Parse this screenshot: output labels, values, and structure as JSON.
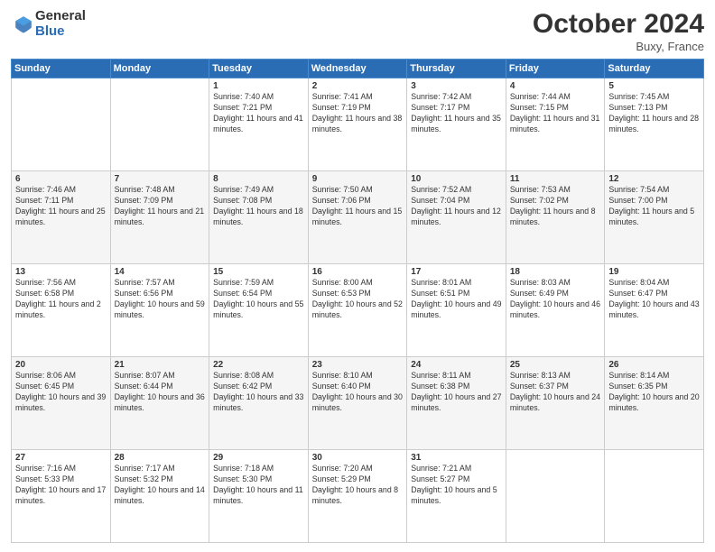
{
  "logo": {
    "general": "General",
    "blue": "Blue"
  },
  "header": {
    "title": "October 2024",
    "location": "Buxy, France"
  },
  "weekdays": [
    "Sunday",
    "Monday",
    "Tuesday",
    "Wednesday",
    "Thursday",
    "Friday",
    "Saturday"
  ],
  "weeks": [
    [
      {
        "day": "",
        "sunrise": "",
        "sunset": "",
        "daylight": ""
      },
      {
        "day": "",
        "sunrise": "",
        "sunset": "",
        "daylight": ""
      },
      {
        "day": "1",
        "sunrise": "Sunrise: 7:40 AM",
        "sunset": "Sunset: 7:21 PM",
        "daylight": "Daylight: 11 hours and 41 minutes."
      },
      {
        "day": "2",
        "sunrise": "Sunrise: 7:41 AM",
        "sunset": "Sunset: 7:19 PM",
        "daylight": "Daylight: 11 hours and 38 minutes."
      },
      {
        "day": "3",
        "sunrise": "Sunrise: 7:42 AM",
        "sunset": "Sunset: 7:17 PM",
        "daylight": "Daylight: 11 hours and 35 minutes."
      },
      {
        "day": "4",
        "sunrise": "Sunrise: 7:44 AM",
        "sunset": "Sunset: 7:15 PM",
        "daylight": "Daylight: 11 hours and 31 minutes."
      },
      {
        "day": "5",
        "sunrise": "Sunrise: 7:45 AM",
        "sunset": "Sunset: 7:13 PM",
        "daylight": "Daylight: 11 hours and 28 minutes."
      }
    ],
    [
      {
        "day": "6",
        "sunrise": "Sunrise: 7:46 AM",
        "sunset": "Sunset: 7:11 PM",
        "daylight": "Daylight: 11 hours and 25 minutes."
      },
      {
        "day": "7",
        "sunrise": "Sunrise: 7:48 AM",
        "sunset": "Sunset: 7:09 PM",
        "daylight": "Daylight: 11 hours and 21 minutes."
      },
      {
        "day": "8",
        "sunrise": "Sunrise: 7:49 AM",
        "sunset": "Sunset: 7:08 PM",
        "daylight": "Daylight: 11 hours and 18 minutes."
      },
      {
        "day": "9",
        "sunrise": "Sunrise: 7:50 AM",
        "sunset": "Sunset: 7:06 PM",
        "daylight": "Daylight: 11 hours and 15 minutes."
      },
      {
        "day": "10",
        "sunrise": "Sunrise: 7:52 AM",
        "sunset": "Sunset: 7:04 PM",
        "daylight": "Daylight: 11 hours and 12 minutes."
      },
      {
        "day": "11",
        "sunrise": "Sunrise: 7:53 AM",
        "sunset": "Sunset: 7:02 PM",
        "daylight": "Daylight: 11 hours and 8 minutes."
      },
      {
        "day": "12",
        "sunrise": "Sunrise: 7:54 AM",
        "sunset": "Sunset: 7:00 PM",
        "daylight": "Daylight: 11 hours and 5 minutes."
      }
    ],
    [
      {
        "day": "13",
        "sunrise": "Sunrise: 7:56 AM",
        "sunset": "Sunset: 6:58 PM",
        "daylight": "Daylight: 11 hours and 2 minutes."
      },
      {
        "day": "14",
        "sunrise": "Sunrise: 7:57 AM",
        "sunset": "Sunset: 6:56 PM",
        "daylight": "Daylight: 10 hours and 59 minutes."
      },
      {
        "day": "15",
        "sunrise": "Sunrise: 7:59 AM",
        "sunset": "Sunset: 6:54 PM",
        "daylight": "Daylight: 10 hours and 55 minutes."
      },
      {
        "day": "16",
        "sunrise": "Sunrise: 8:00 AM",
        "sunset": "Sunset: 6:53 PM",
        "daylight": "Daylight: 10 hours and 52 minutes."
      },
      {
        "day": "17",
        "sunrise": "Sunrise: 8:01 AM",
        "sunset": "Sunset: 6:51 PM",
        "daylight": "Daylight: 10 hours and 49 minutes."
      },
      {
        "day": "18",
        "sunrise": "Sunrise: 8:03 AM",
        "sunset": "Sunset: 6:49 PM",
        "daylight": "Daylight: 10 hours and 46 minutes."
      },
      {
        "day": "19",
        "sunrise": "Sunrise: 8:04 AM",
        "sunset": "Sunset: 6:47 PM",
        "daylight": "Daylight: 10 hours and 43 minutes."
      }
    ],
    [
      {
        "day": "20",
        "sunrise": "Sunrise: 8:06 AM",
        "sunset": "Sunset: 6:45 PM",
        "daylight": "Daylight: 10 hours and 39 minutes."
      },
      {
        "day": "21",
        "sunrise": "Sunrise: 8:07 AM",
        "sunset": "Sunset: 6:44 PM",
        "daylight": "Daylight: 10 hours and 36 minutes."
      },
      {
        "day": "22",
        "sunrise": "Sunrise: 8:08 AM",
        "sunset": "Sunset: 6:42 PM",
        "daylight": "Daylight: 10 hours and 33 minutes."
      },
      {
        "day": "23",
        "sunrise": "Sunrise: 8:10 AM",
        "sunset": "Sunset: 6:40 PM",
        "daylight": "Daylight: 10 hours and 30 minutes."
      },
      {
        "day": "24",
        "sunrise": "Sunrise: 8:11 AM",
        "sunset": "Sunset: 6:38 PM",
        "daylight": "Daylight: 10 hours and 27 minutes."
      },
      {
        "day": "25",
        "sunrise": "Sunrise: 8:13 AM",
        "sunset": "Sunset: 6:37 PM",
        "daylight": "Daylight: 10 hours and 24 minutes."
      },
      {
        "day": "26",
        "sunrise": "Sunrise: 8:14 AM",
        "sunset": "Sunset: 6:35 PM",
        "daylight": "Daylight: 10 hours and 20 minutes."
      }
    ],
    [
      {
        "day": "27",
        "sunrise": "Sunrise: 7:16 AM",
        "sunset": "Sunset: 5:33 PM",
        "daylight": "Daylight: 10 hours and 17 minutes."
      },
      {
        "day": "28",
        "sunrise": "Sunrise: 7:17 AM",
        "sunset": "Sunset: 5:32 PM",
        "daylight": "Daylight: 10 hours and 14 minutes."
      },
      {
        "day": "29",
        "sunrise": "Sunrise: 7:18 AM",
        "sunset": "Sunset: 5:30 PM",
        "daylight": "Daylight: 10 hours and 11 minutes."
      },
      {
        "day": "30",
        "sunrise": "Sunrise: 7:20 AM",
        "sunset": "Sunset: 5:29 PM",
        "daylight": "Daylight: 10 hours and 8 minutes."
      },
      {
        "day": "31",
        "sunrise": "Sunrise: 7:21 AM",
        "sunset": "Sunset: 5:27 PM",
        "daylight": "Daylight: 10 hours and 5 minutes."
      },
      {
        "day": "",
        "sunrise": "",
        "sunset": "",
        "daylight": ""
      },
      {
        "day": "",
        "sunrise": "",
        "sunset": "",
        "daylight": ""
      }
    ]
  ]
}
